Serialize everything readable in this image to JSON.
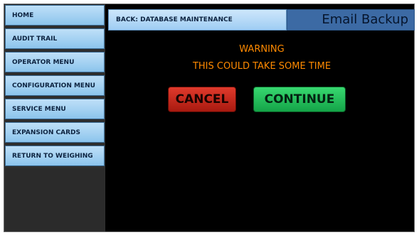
{
  "sidebar": {
    "items": [
      {
        "label": "HOME"
      },
      {
        "label": "AUDIT TRAIL"
      },
      {
        "label": "OPERATOR MENU"
      },
      {
        "label": "CONFIGURATION MENU"
      },
      {
        "label": "SERVICE MENU"
      },
      {
        "label": "EXPANSION CARDS"
      },
      {
        "label": "RETURN TO WEIGHING"
      }
    ]
  },
  "header": {
    "back_label": "BACK: DATABASE MAINTENANCE",
    "title": "Email Backup"
  },
  "message": {
    "line1": "WARNING",
    "line2": "THIS COULD TAKE SOME TIME"
  },
  "buttons": {
    "cancel": "CANCEL",
    "continue": "CONTINUE"
  },
  "colors": {
    "warning_text": "#ff8a00",
    "cancel": "#c7261a",
    "continue": "#28c85e",
    "nav_button": "#a8d2f2",
    "title_bar": "#3c6aa4"
  }
}
